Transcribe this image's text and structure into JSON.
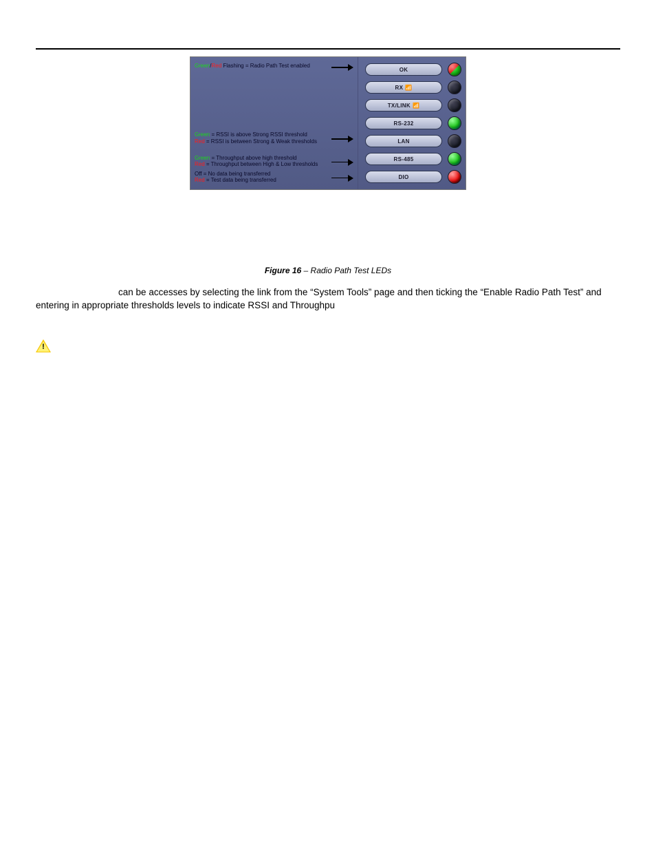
{
  "caption": {
    "label": "Figure 16",
    "title": " – Radio Path Test LEDs"
  },
  "para1_leadspace": "                               ",
  "para1": " can be accesses by selecting the link from the “System Tools” page and then ticking the “Enable Radio Path Test” and entering in appropriate thresholds levels to indicate RSSI and Throughpu",
  "legend": {
    "ok": {
      "g": "Green",
      "sep": "/",
      "r": "Red",
      "rest": " Flashing = Radio Path Test enabled"
    },
    "rssi": {
      "g": "Green",
      "gline": " = RSSI is above Strong RSSI threshold",
      "r": "Red",
      "rline": " = RSSI is between Strong & Weak thresholds"
    },
    "thr": {
      "g": "Green",
      "gline": " = Throughput above high threshold",
      "r": "Red",
      "rline": " = Throughput between High & Low thresholds"
    },
    "dio": {
      "off": "Off",
      "offline": " = No data being transferred",
      "r": "Red",
      "rline": " = Test data being transferred"
    }
  },
  "panel": {
    "rows": [
      {
        "label": "OK",
        "icon": "",
        "led": "redgreen"
      },
      {
        "label": "RX",
        "icon": "ant",
        "led": "off"
      },
      {
        "label": "TX/LINK",
        "icon": "ant",
        "led": "off"
      },
      {
        "label": "RS-232",
        "icon": "",
        "led": "green"
      },
      {
        "label": "LAN",
        "icon": "",
        "led": "off"
      },
      {
        "label": "RS-485",
        "icon": "",
        "led": "green"
      },
      {
        "label": "DIO",
        "icon": "",
        "led": "red"
      }
    ]
  }
}
